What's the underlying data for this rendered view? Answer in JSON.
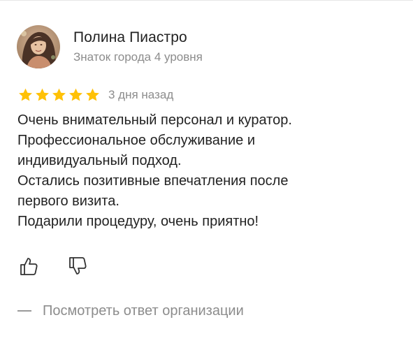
{
  "author": {
    "name": "Полина Пиастро",
    "level": "Знаток города 4 уровня"
  },
  "review": {
    "rating": 5,
    "rating_max": 5,
    "date": "3 дня назад",
    "lines": [
      "Очень внимательный персонал и куратор.",
      "Профессиональное обслуживание и",
      "индивидуальный подход.",
      "Остались позитивные впечатления после",
      "первого визита.",
      "Подарили процедуру, очень приятно!"
    ]
  },
  "actions": {
    "like_icon": "thumbs-up-icon",
    "dislike_icon": "thumbs-down-icon",
    "org_reply_label": "Посмотреть ответ организации"
  },
  "colors": {
    "star": "#FFC107",
    "muted_text": "#8C8C8C",
    "text": "#222222"
  }
}
